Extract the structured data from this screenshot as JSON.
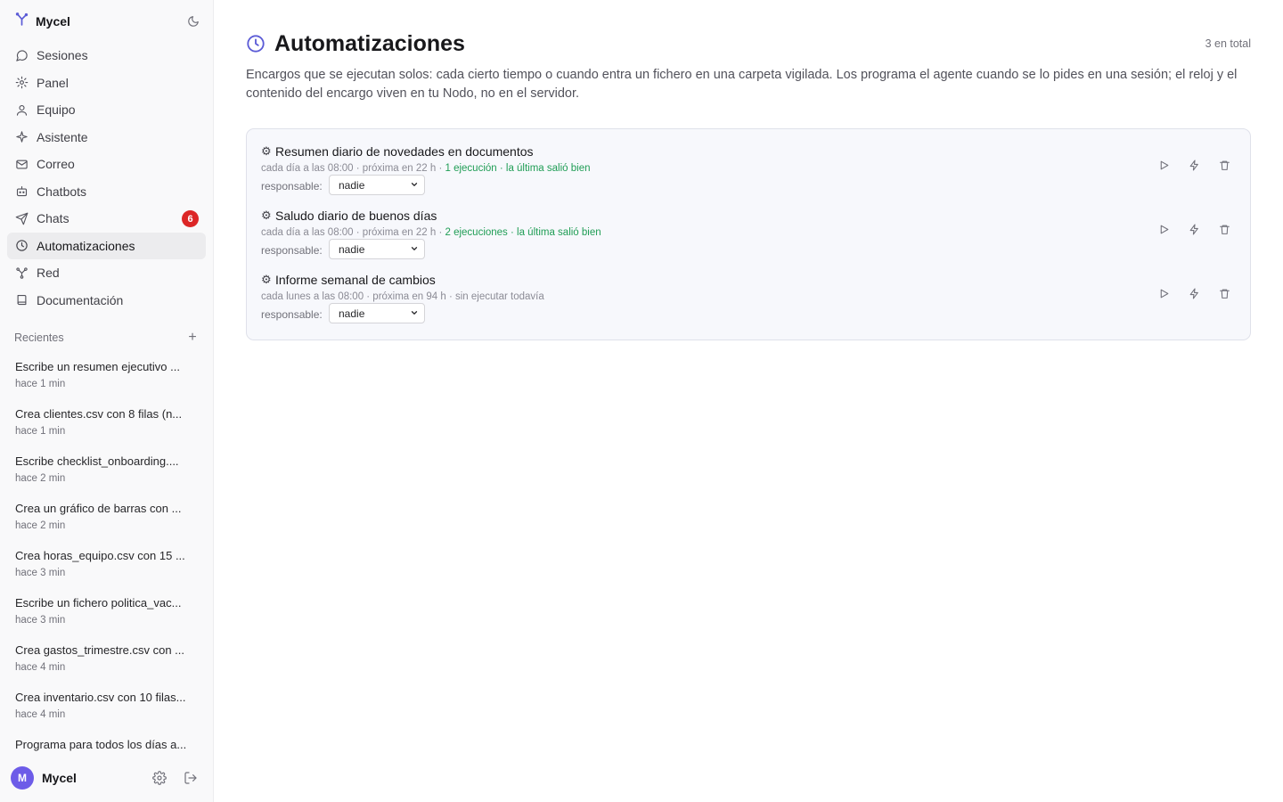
{
  "app": {
    "name": "Mycel"
  },
  "sidebar": {
    "nav": [
      {
        "label": "Sesiones",
        "icon": "chat-bubble-icon"
      },
      {
        "label": "Panel",
        "icon": "cog-panel-icon"
      },
      {
        "label": "Equipo",
        "icon": "person-icon"
      },
      {
        "label": "Asistente",
        "icon": "sparkle-icon"
      },
      {
        "label": "Correo",
        "icon": "mail-icon"
      },
      {
        "label": "Chatbots",
        "icon": "bot-icon"
      },
      {
        "label": "Chats",
        "icon": "send-icon",
        "badge": "6"
      },
      {
        "label": "Automatizaciones",
        "icon": "clock-icon",
        "active": true
      },
      {
        "label": "Red",
        "icon": "network-icon"
      },
      {
        "label": "Documentación",
        "icon": "book-icon"
      }
    ],
    "recents": {
      "title": "Recientes",
      "add_label": "+",
      "items": [
        {
          "title": "Escribe un resumen ejecutivo ...",
          "time": "hace 1 min"
        },
        {
          "title": "Crea clientes.csv con 8 filas (n...",
          "time": "hace 1 min"
        },
        {
          "title": "Escribe checklist_onboarding....",
          "time": "hace 2 min"
        },
        {
          "title": "Crea un gráfico de barras con ...",
          "time": "hace 2 min"
        },
        {
          "title": "Crea horas_equipo.csv con 15 ...",
          "time": "hace 3 min"
        },
        {
          "title": "Escribe un fichero politica_vac...",
          "time": "hace 3 min"
        },
        {
          "title": "Crea gastos_trimestre.csv con ...",
          "time": "hace 4 min"
        },
        {
          "title": "Crea inventario.csv con 10 filas...",
          "time": "hace 4 min"
        },
        {
          "title": "Programa para todos los días a...",
          "time": ""
        }
      ]
    },
    "user": {
      "initial": "M",
      "name": "Mycel"
    }
  },
  "main": {
    "title": "Automatizaciones",
    "count": "3 en total",
    "description": "Encargos que se ejecutan solos: cada cierto tiempo o cuando entra un fichero en una carpeta vigilada. Los programa el agente cuando se lo pides en una sesión; el reloj y el contenido del encargo viven en tu Nodo, no en el servidor.",
    "responsable_label": "responsable:",
    "automations": [
      {
        "name": "Resumen diario de novedades en documentos",
        "schedule": "cada día a las 08:00 · próxima en 22 h · ",
        "status": "1 ejecución · la última salió bien",
        "status_ok": true,
        "responsable": "nadie"
      },
      {
        "name": "Saludo diario de buenos días",
        "schedule": "cada día a las 08:00 · próxima en 22 h · ",
        "status": "2 ejecuciones · la última salió bien",
        "status_ok": true,
        "responsable": "nadie"
      },
      {
        "name": "Informe semanal de cambios",
        "schedule": "cada lunes a las 08:00 · próxima en 94 h · ",
        "status": "sin ejecutar todavía",
        "status_ok": false,
        "responsable": "nadie"
      }
    ]
  },
  "colors": {
    "accent": "#5b5bd6",
    "ok": "#1f9d55",
    "badge": "#dc2626",
    "avatar": "#6d5ce8"
  }
}
